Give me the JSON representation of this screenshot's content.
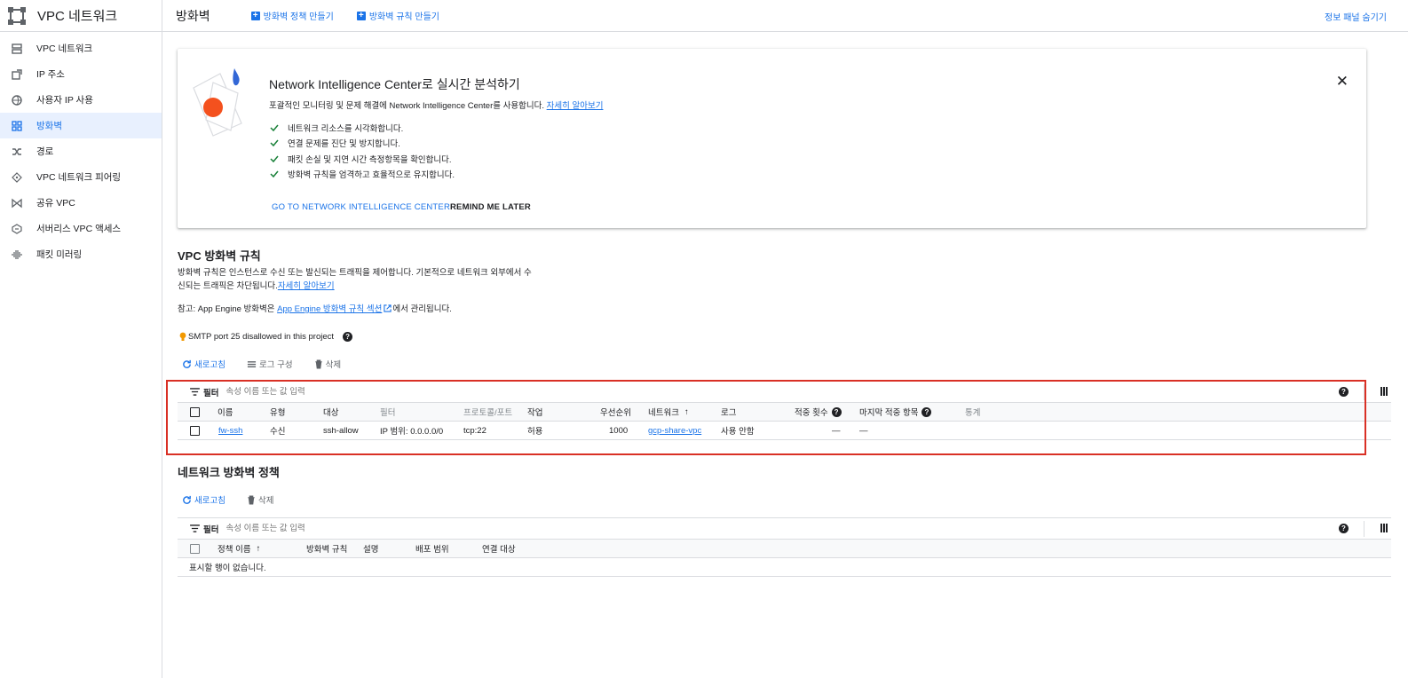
{
  "sidebar": {
    "title": "VPC 네트워크",
    "items": [
      {
        "label": "VPC 네트워크",
        "icon": "vpc-network-icon"
      },
      {
        "label": "IP 주소",
        "icon": "ip-address-icon"
      },
      {
        "label": "사용자 IP 사용",
        "icon": "byoip-icon"
      },
      {
        "label": "방화벽",
        "icon": "firewall-icon",
        "active": true
      },
      {
        "label": "경로",
        "icon": "routes-icon"
      },
      {
        "label": "VPC 네트워크 피어링",
        "icon": "peering-icon"
      },
      {
        "label": "공유 VPC",
        "icon": "shared-vpc-icon"
      },
      {
        "label": "서버리스 VPC 액세스",
        "icon": "serverless-icon"
      },
      {
        "label": "패킷 미러링",
        "icon": "packet-mirroring-icon"
      }
    ]
  },
  "topbar": {
    "title": "방화벽",
    "create_policy": "방화벽 정책 만들기",
    "create_rule": "방화벽 규칙 만들기",
    "hide_panel": "정보 패널 숨기기"
  },
  "banner": {
    "title": "Network Intelligence Center로 실시간 분석하기",
    "desc": "포괄적인 모니터링 및 문제 해결에 Network Intelligence Center를 사용합니다.",
    "learn_more": "자세히 알아보기",
    "checks": [
      "네트워크 리소스를 시각화합니다.",
      "연결 문제를 진단 및 방지합니다.",
      "패킷 손실 및 지연 시간 측정항목을 확인합니다.",
      "방화벽 규칙을 엄격하고 효율적으로 유지합니다."
    ],
    "go_button": "GO TO NETWORK INTELLIGENCE CENTER",
    "remind_button": "REMIND ME LATER"
  },
  "rules_section": {
    "title": "VPC 방화벽 규칙",
    "desc_line1": "방화벽 규칙은 인스턴스로 수신 또는 발신되는 트래픽을 제어합니다. 기본적으로 네트워크 외부에서 수",
    "desc_line2": "신되는 트래픽은 차단됩니다.",
    "learn_more": "자세히 알아보기",
    "note_prefix": "참고: App Engine 방화벽은 ",
    "note_link": "App Engine 방화벽 규칙 섹션",
    "note_suffix": "에서 관리됩니다.",
    "smtp": "SMTP port 25 disallowed in this project",
    "refresh": "새로고침",
    "log_config": "로그 구성",
    "delete": "삭제",
    "filter_label": "필터",
    "filter_placeholder": "속성 이름 또는 값 입력",
    "headers": {
      "name": "이름",
      "type": "유형",
      "target": "대상",
      "filter": "필터",
      "protocol": "프로토콜/포트",
      "action": "작업",
      "priority": "우선순위",
      "network": "네트워크",
      "logs": "로그",
      "hits": "적중 횟수",
      "last_hit": "마지막 적중 항목",
      "insights": "통계"
    },
    "rows": [
      {
        "name": "fw-ssh",
        "type": "수신",
        "target": "ssh-allow",
        "filter": "IP 범위: 0.0.0.0/0",
        "protocol": "tcp:22",
        "action": "허용",
        "priority": "1000",
        "network": "gcp-share-vpc",
        "logs": "사용 안함",
        "hits": "—",
        "last_hit": "—"
      }
    ]
  },
  "policy_section": {
    "title": "네트워크 방화벽 정책",
    "refresh": "새로고침",
    "delete": "삭제",
    "filter_label": "필터",
    "filter_placeholder": "속성 이름 또는 값 입력",
    "headers": {
      "policy_name": "정책 이름",
      "rules": "방화벽 규칙",
      "description": "설명",
      "deploy_scope": "배포 범위",
      "associations": "연결 대상"
    },
    "empty": "표시할 행이 없습니다."
  },
  "colors": {
    "accent": "#1a73e8",
    "highlight": "#d93025",
    "banner_dot": "#f4511e"
  }
}
